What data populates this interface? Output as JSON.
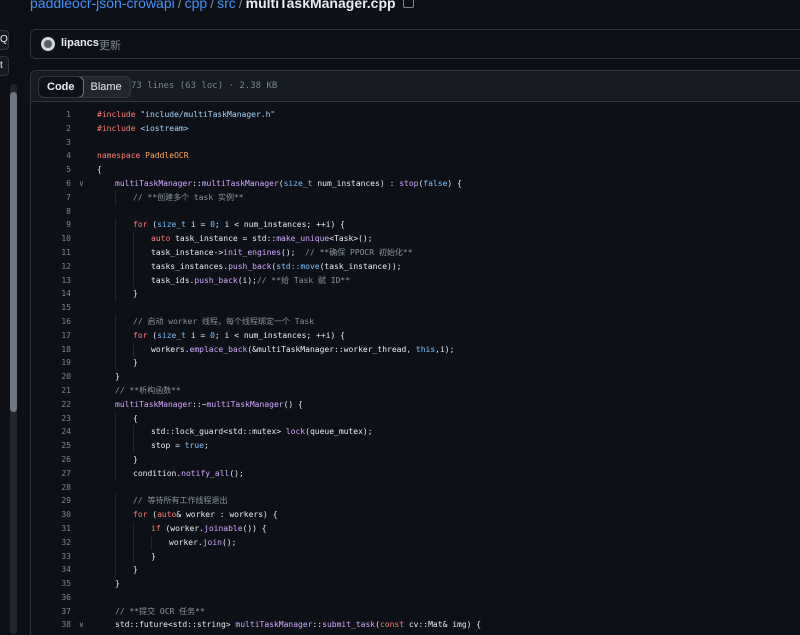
{
  "breadcrumb": {
    "repo": "paddleocr-json-crowapi",
    "sep1": "/",
    "dir1": "cpp",
    "sep2": "/",
    "dir2": "src",
    "sep3": "/",
    "file": "multiTaskManager.cpp"
  },
  "left_tabs": [
    "Q",
    "t"
  ],
  "commit": {
    "author": "lipancs",
    "message": "更新"
  },
  "toolbar": {
    "code_label": "Code",
    "blame_label": "Blame",
    "stats": "73 lines (63 loc) · 2.38 KB"
  },
  "code_lines": [
    {
      "n": "1",
      "fold": false,
      "indent": 0,
      "tokens": [
        [
          "pp",
          "#include "
        ],
        [
          "st",
          "\"include/multiTaskManager.h\""
        ]
      ]
    },
    {
      "n": "2",
      "fold": false,
      "indent": 0,
      "tokens": [
        [
          "pp",
          "#include "
        ],
        [
          "st",
          "<iostream>"
        ]
      ]
    },
    {
      "n": "3",
      "fold": false,
      "indent": 0,
      "tokens": []
    },
    {
      "n": "4",
      "fold": false,
      "indent": 0,
      "tokens": [
        [
          "kw",
          "namespace "
        ],
        [
          "ns",
          "PaddleOCR"
        ]
      ]
    },
    {
      "n": "5",
      "fold": false,
      "indent": 0,
      "tokens": [
        [
          "",
          "{"
        ]
      ]
    },
    {
      "n": "6",
      "fold": true,
      "indent": 1,
      "tokens": [
        [
          "fn",
          "multiTaskManager"
        ],
        [
          "",
          "::"
        ],
        [
          "fn",
          "multiTaskManager"
        ],
        [
          "",
          "("
        ],
        [
          "ty",
          "size_t"
        ],
        [
          "",
          " num_instances) : "
        ],
        [
          "fn",
          "stop"
        ],
        [
          "",
          "("
        ],
        [
          "ty",
          "false"
        ],
        [
          "",
          ") {"
        ]
      ]
    },
    {
      "n": "7",
      "fold": false,
      "indent": 2,
      "tokens": [
        [
          "cm",
          "// **创建多个 task 实例**"
        ]
      ]
    },
    {
      "n": "8",
      "fold": false,
      "indent": 0,
      "tokens": []
    },
    {
      "n": "9",
      "fold": false,
      "indent": 2,
      "tokens": [
        [
          "kw",
          "for"
        ],
        [
          "",
          " ("
        ],
        [
          "ty",
          "size_t"
        ],
        [
          "",
          " i = "
        ],
        [
          "ty",
          "0"
        ],
        [
          "",
          "; i < num_instances; ++i) {"
        ]
      ]
    },
    {
      "n": "10",
      "fold": false,
      "indent": 3,
      "tokens": [
        [
          "kw",
          "auto"
        ],
        [
          "",
          " task_instance = std::"
        ],
        [
          "fn",
          "make_unique"
        ],
        [
          "",
          "<Task>();"
        ]
      ]
    },
    {
      "n": "11",
      "fold": false,
      "indent": 3,
      "tokens": [
        [
          "",
          "task_instance->"
        ],
        [
          "fn",
          "init_engines"
        ],
        [
          "",
          "();  "
        ],
        [
          "cm",
          "// **确保 PPOCR 初始化**"
        ]
      ]
    },
    {
      "n": "12",
      "fold": false,
      "indent": 3,
      "tokens": [
        [
          "",
          "tasks_instances."
        ],
        [
          "fn",
          "push_back"
        ],
        [
          "",
          "("
        ],
        [
          "ty",
          "std::move"
        ],
        [
          "",
          "(task_instance));"
        ]
      ]
    },
    {
      "n": "13",
      "fold": false,
      "indent": 3,
      "tokens": [
        [
          "",
          "task_ids."
        ],
        [
          "fn",
          "push_back"
        ],
        [
          "",
          "(i);"
        ],
        [
          "cm",
          "// **给 Task 赋 ID**"
        ]
      ]
    },
    {
      "n": "14",
      "fold": false,
      "indent": 2,
      "tokens": [
        [
          "",
          "}"
        ]
      ]
    },
    {
      "n": "15",
      "fold": false,
      "indent": 0,
      "tokens": []
    },
    {
      "n": "16",
      "fold": false,
      "indent": 2,
      "tokens": [
        [
          "cm",
          "// 启动 worker 线程，每个线程绑定一个 Task"
        ]
      ]
    },
    {
      "n": "17",
      "fold": false,
      "indent": 2,
      "tokens": [
        [
          "kw",
          "for"
        ],
        [
          "",
          " ("
        ],
        [
          "ty",
          "size_t"
        ],
        [
          "",
          " i = "
        ],
        [
          "ty",
          "0"
        ],
        [
          "",
          "; i < num_instances; ++i) {"
        ]
      ]
    },
    {
      "n": "18",
      "fold": false,
      "indent": 3,
      "tokens": [
        [
          "",
          "workers."
        ],
        [
          "fn",
          "emplace_back"
        ],
        [
          "",
          "(&multiTaskManager::worker_thread, "
        ],
        [
          "ty",
          "this"
        ],
        [
          "",
          ",i);"
        ]
      ]
    },
    {
      "n": "19",
      "fold": false,
      "indent": 2,
      "tokens": [
        [
          "",
          "}"
        ]
      ]
    },
    {
      "n": "20",
      "fold": false,
      "indent": 1,
      "tokens": [
        [
          "",
          "}"
        ]
      ]
    },
    {
      "n": "21",
      "fold": false,
      "indent": 1,
      "tokens": [
        [
          "cm",
          "// **析构函数**"
        ]
      ]
    },
    {
      "n": "22",
      "fold": false,
      "indent": 1,
      "tokens": [
        [
          "fn",
          "multiTaskManager"
        ],
        [
          "",
          "::~"
        ],
        [
          "fn",
          "multiTaskManager"
        ],
        [
          "",
          "() {"
        ]
      ]
    },
    {
      "n": "23",
      "fold": false,
      "indent": 2,
      "tokens": [
        [
          "",
          "{"
        ]
      ]
    },
    {
      "n": "24",
      "fold": false,
      "indent": 3,
      "tokens": [
        [
          "",
          "std::lock_guard<std::mutex> "
        ],
        [
          "fn",
          "lock"
        ],
        [
          "",
          "(queue_mutex);"
        ]
      ]
    },
    {
      "n": "25",
      "fold": false,
      "indent": 3,
      "tokens": [
        [
          "",
          "stop = "
        ],
        [
          "ty",
          "true"
        ],
        [
          "",
          ";"
        ]
      ]
    },
    {
      "n": "26",
      "fold": false,
      "indent": 2,
      "tokens": [
        [
          "",
          "}"
        ]
      ]
    },
    {
      "n": "27",
      "fold": false,
      "indent": 2,
      "tokens": [
        [
          "",
          "condition."
        ],
        [
          "fn",
          "notify_all"
        ],
        [
          "",
          "();"
        ]
      ]
    },
    {
      "n": "28",
      "fold": false,
      "indent": 0,
      "tokens": []
    },
    {
      "n": "29",
      "fold": false,
      "indent": 2,
      "tokens": [
        [
          "cm",
          "// 等待所有工作线程退出"
        ]
      ]
    },
    {
      "n": "30",
      "fold": false,
      "indent": 2,
      "tokens": [
        [
          "kw",
          "for"
        ],
        [
          "",
          " ("
        ],
        [
          "kw",
          "auto"
        ],
        [
          "",
          "& worker : workers) {"
        ]
      ]
    },
    {
      "n": "31",
      "fold": false,
      "indent": 3,
      "tokens": [
        [
          "kw",
          "if"
        ],
        [
          "",
          " (worker."
        ],
        [
          "fn",
          "joinable"
        ],
        [
          "",
          "()) {"
        ]
      ]
    },
    {
      "n": "32",
      "fold": false,
      "indent": 4,
      "tokens": [
        [
          "",
          "worker."
        ],
        [
          "fn",
          "join"
        ],
        [
          "",
          "();"
        ]
      ]
    },
    {
      "n": "33",
      "fold": false,
      "indent": 3,
      "tokens": [
        [
          "",
          "}"
        ]
      ]
    },
    {
      "n": "34",
      "fold": false,
      "indent": 2,
      "tokens": [
        [
          "",
          "}"
        ]
      ]
    },
    {
      "n": "35",
      "fold": false,
      "indent": 1,
      "tokens": [
        [
          "",
          "}"
        ]
      ]
    },
    {
      "n": "36",
      "fold": false,
      "indent": 0,
      "tokens": []
    },
    {
      "n": "37",
      "fold": false,
      "indent": 1,
      "tokens": [
        [
          "cm",
          "// **提交 OCR 任务**"
        ]
      ]
    },
    {
      "n": "38",
      "fold": true,
      "indent": 1,
      "tokens": [
        [
          "",
          "std::future<std::string> "
        ],
        [
          "fn",
          "multiTaskManager"
        ],
        [
          "",
          "::"
        ],
        [
          "fn",
          "submit_task"
        ],
        [
          "",
          "("
        ],
        [
          "kw",
          "const"
        ],
        [
          "",
          " cv::Mat& img) {"
        ]
      ]
    }
  ],
  "colors": {
    "background": "#0d1117",
    "link": "#4493f8",
    "border": "#30363d"
  },
  "icons": [
    "copy-icon",
    "avatar",
    "chevron-down-icon"
  ]
}
